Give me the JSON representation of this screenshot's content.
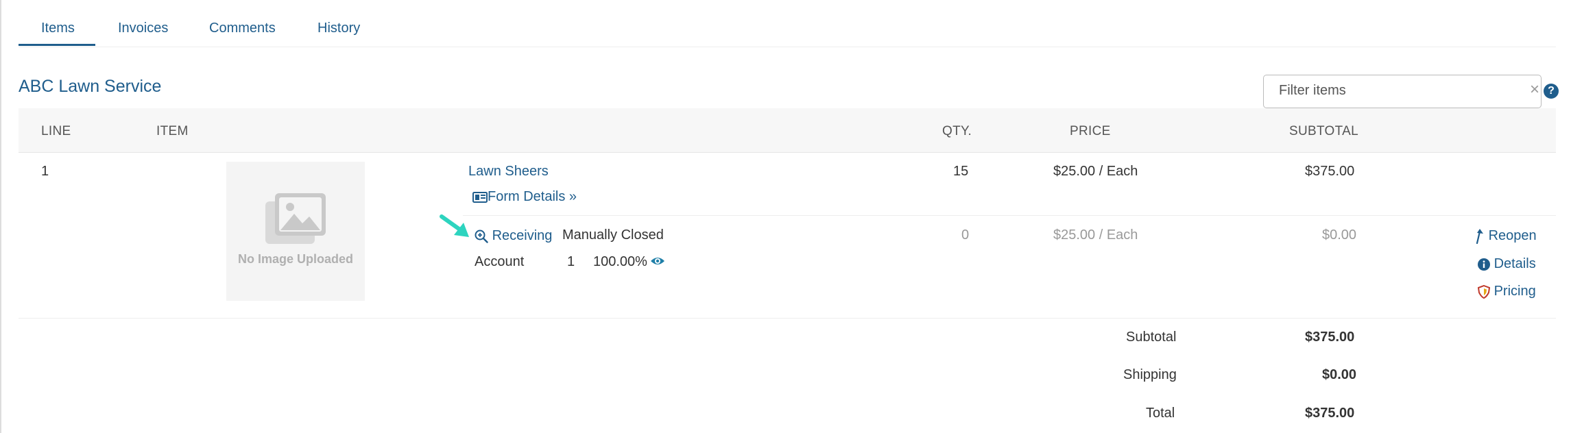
{
  "tabs": [
    {
      "label": "Items",
      "active": true
    },
    {
      "label": "Invoices"
    },
    {
      "label": "Comments"
    },
    {
      "label": "History"
    }
  ],
  "vendor": {
    "name": "ABC Lawn Service"
  },
  "filter": {
    "placeholder": "Filter items",
    "clear_glyph": "×",
    "help_glyph": "?"
  },
  "columns": {
    "line": "LINE",
    "item": "ITEM",
    "qty": "QTY.",
    "price": "PRICE",
    "subtotal": "SUBTOTAL"
  },
  "line_item": {
    "line": "1",
    "image_caption": "No Image Uploaded",
    "name": "Lawn Sheers",
    "form_details": "Form Details »",
    "qty": "15",
    "price": "$25.00 / Each",
    "subtotal": "$375.00"
  },
  "receiving": {
    "label": "Receiving",
    "status": "Manually Closed",
    "qty": "0",
    "price": "$25.00 / Each",
    "subtotal": "$0.00",
    "account_label": "Account",
    "account_number": "1",
    "account_percent": "100.00%"
  },
  "actions": {
    "reopen": "Reopen",
    "details": "Details",
    "pricing": "Pricing"
  },
  "totals": [
    {
      "label": "Subtotal",
      "value": "$375.00"
    },
    {
      "label": "Shipping",
      "value": "$0.00"
    },
    {
      "label": "Total",
      "value": "$375.00"
    }
  ],
  "colors": {
    "link": "#1f5d8c",
    "annotation_arrow": "#2dd4bf",
    "pricing_shield": "#c0392b"
  },
  "icons": [
    "form-details-icon",
    "zoom-in-icon",
    "eye-icon",
    "reopen-arrow-icon",
    "info-icon",
    "pricing-shield-icon",
    "image-placeholder-icon",
    "help-icon",
    "clear-icon"
  ]
}
